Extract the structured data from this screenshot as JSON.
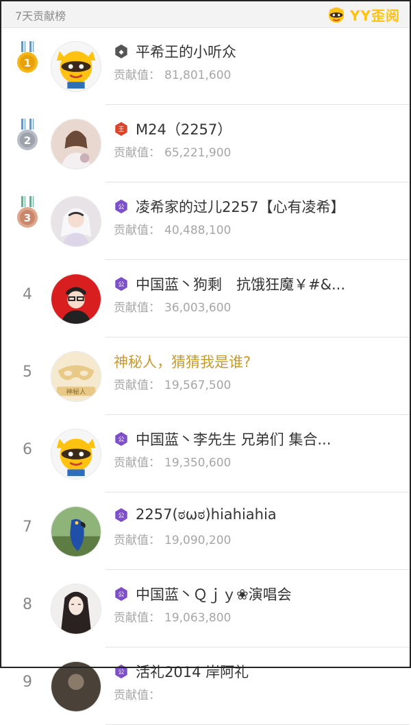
{
  "header": {
    "title": "7天贡献榜",
    "logo_text": "YY歪阅"
  },
  "contribution_label": "贡献值：",
  "colors": {
    "gold_name": "#c89a2a",
    "badge_purple": "#7d4fc8",
    "badge_red": "#d9442b",
    "badge_gray": "#555555"
  },
  "rows": [
    {
      "rank": "1",
      "medal": "gold",
      "avatar": "yy-mascot",
      "level_badge": "gray-hex-icon",
      "name": "平希王的小听众",
      "value": "81,801,600"
    },
    {
      "rank": "2",
      "medal": "silver",
      "avatar": "girl-photo",
      "level_badge": "red-hex-icon",
      "name": "M24（2257）",
      "value": "65,221,900"
    },
    {
      "rank": "3",
      "medal": "bronze",
      "avatar": "girl-white-hair",
      "level_badge": "purple-hex-icon",
      "name": "凌希家的过儿2257【心有凌希】",
      "value": "40,488,100"
    },
    {
      "rank": "4",
      "medal": "",
      "avatar": "cartoon-man-red",
      "level_badge": "purple-hex-icon",
      "name": "中国蓝丶狗剩　抗饿狂魔￥#&...",
      "value": "36,003,600"
    },
    {
      "rank": "5",
      "medal": "",
      "avatar": "mystery-mask",
      "avatar_text": "神秘人",
      "level_badge": "",
      "name": "神秘人，猜猜我是谁?",
      "value": "19,567,500"
    },
    {
      "rank": "6",
      "medal": "",
      "avatar": "yy-mascot",
      "level_badge": "purple-hex-icon",
      "name": "中国蓝丶李先生 兄弟们 集合...",
      "value": "19,350,600"
    },
    {
      "rank": "7",
      "medal": "",
      "avatar": "blue-parrot",
      "level_badge": "purple-hex-icon",
      "name": "2257(ಠωಠ)hiahiahia",
      "value": "19,090,200"
    },
    {
      "rank": "8",
      "medal": "",
      "avatar": "long-hair-drawing",
      "level_badge": "purple-hex-icon",
      "name": "中国蓝丶Ｑｊｙ❀演唱会",
      "value": "19,063,800"
    },
    {
      "rank": "9",
      "medal": "",
      "avatar": "dark-photo",
      "level_badge": "purple-hex-icon",
      "name": "活礼2014 岸阿礼",
      "value": ""
    }
  ]
}
